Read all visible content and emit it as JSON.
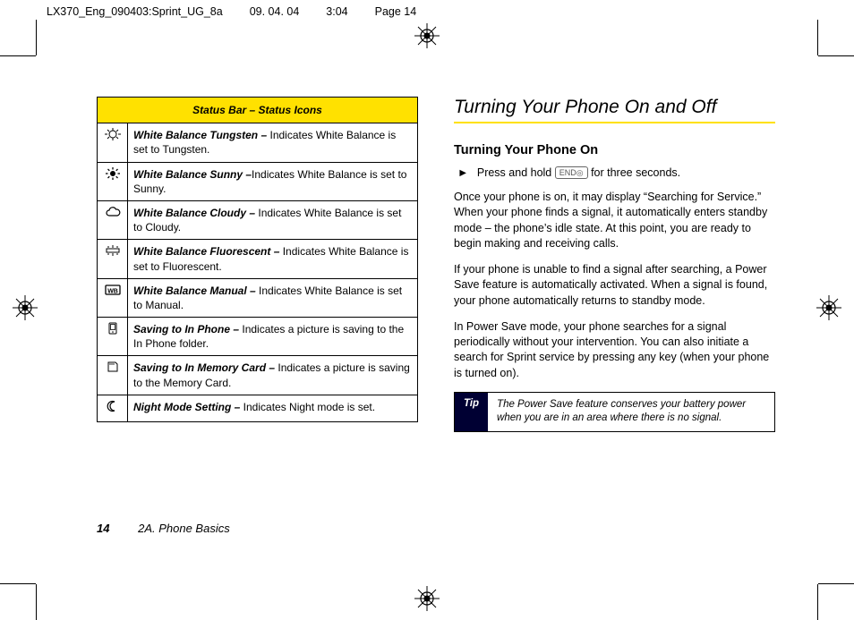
{
  "job": {
    "file": "LX370_Eng_090403:Sprint_UG_8a",
    "date": "09. 04. 04",
    "time": "3:04",
    "pagelabel": "Page 14"
  },
  "table": {
    "header": "Status Bar – Status Icons",
    "rows": [
      {
        "icon": "wb-tungsten-icon",
        "term": "White Balance Tungsten – ",
        "desc": "Indicates White Balance is set to Tungsten."
      },
      {
        "icon": "wb-sunny-icon",
        "term": "White Balance Sunny –",
        "desc": "Indicates White Balance is set to Sunny."
      },
      {
        "icon": "wb-cloudy-icon",
        "term": "White Balance Cloudy – ",
        "desc": "Indicates White Balance is set to Cloudy."
      },
      {
        "icon": "wb-fluorescent-icon",
        "term": "White Balance Fluorescent – ",
        "desc": "Indicates White Balance is set to Fluorescent."
      },
      {
        "icon": "wb-manual-icon",
        "term": "White Balance Manual – ",
        "desc": "Indicates White Balance is set to Manual."
      },
      {
        "icon": "save-phone-icon",
        "term": "Saving to In Phone – ",
        "desc": "Indicates a picture is saving to the In Phone folder."
      },
      {
        "icon": "save-memcard-icon",
        "term": "Saving to In Memory Card – ",
        "desc": "Indicates a picture is saving to the Memory Card."
      },
      {
        "icon": "night-mode-icon",
        "term": "Night Mode Setting – ",
        "desc": "Indicates Night mode is set."
      }
    ]
  },
  "right": {
    "heading": "Turning Your Phone On and Off",
    "sub1": "Turning Your Phone On",
    "step1a": "Press and hold ",
    "keycap": "END◎",
    "step1b": " for three seconds.",
    "p1": "Once your phone is on, it may display “Searching for Service.”  When your phone finds a signal, it automatically enters standby mode – the phone’s idle state. At this point, you are ready to begin making and receiving calls.",
    "p2": "If your phone is unable to find a signal after searching, a Power Save feature is automatically activated. When a signal is found, your phone automatically returns to standby mode.",
    "p3": "In Power Save mode, your phone searches for a signal periodically without your intervention. You can also initiate a search for Sprint service by pressing any key (when your phone is turned on).",
    "tip_label": "Tip",
    "tip_text": "The Power Save feature conserves your battery power when you are in an area where there is no signal."
  },
  "footer": {
    "page": "14",
    "section": "2A. Phone Basics"
  }
}
